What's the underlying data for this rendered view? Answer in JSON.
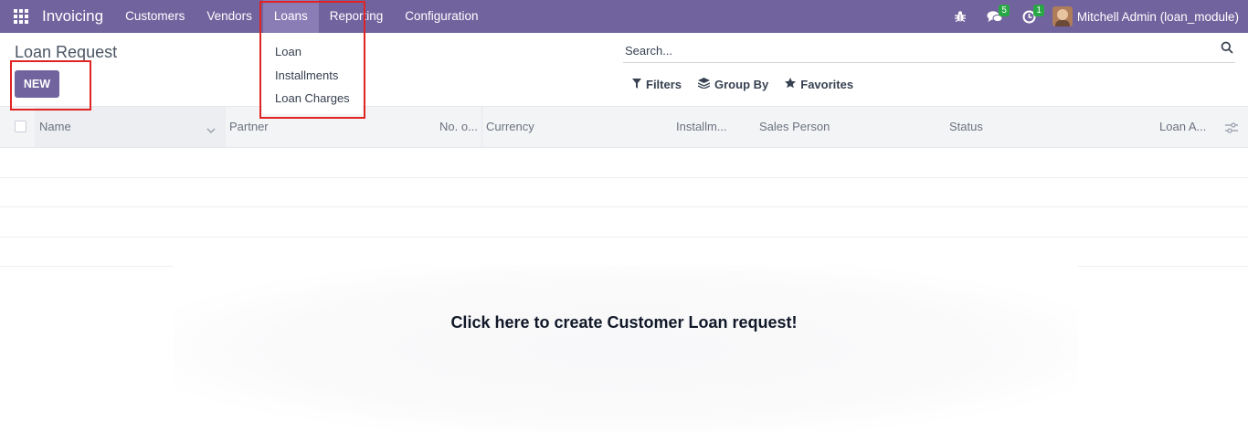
{
  "navbar": {
    "app_name": "Invoicing",
    "menu": [
      {
        "label": "Customers"
      },
      {
        "label": "Vendors"
      },
      {
        "label": "Loans"
      },
      {
        "label": "Reporting"
      },
      {
        "label": "Configuration"
      }
    ],
    "messages_count": "5",
    "activities_count": "1",
    "user_name": "Mitchell Admin (loan_module)",
    "bg_color": "#71639e"
  },
  "loans_dropdown": {
    "items": [
      {
        "label": "Loan"
      },
      {
        "label": "Installments"
      },
      {
        "label": "Loan Charges"
      }
    ]
  },
  "control_panel": {
    "title": "Loan Request",
    "new_label": "NEW",
    "search_placeholder": "Search...",
    "filters_label": "Filters",
    "group_by_label": "Group By",
    "favorites_label": "Favorites"
  },
  "list": {
    "columns": [
      "Name",
      "Partner",
      "No. o...",
      "Currency",
      "Installm...",
      "Sales Person",
      "Status",
      "Loan A..."
    ]
  },
  "empty_state": {
    "message": "Click here to create Customer Loan request!"
  },
  "colors": {
    "primary": "#71639e",
    "highlight": "#e02424",
    "badge": "#28a745"
  }
}
